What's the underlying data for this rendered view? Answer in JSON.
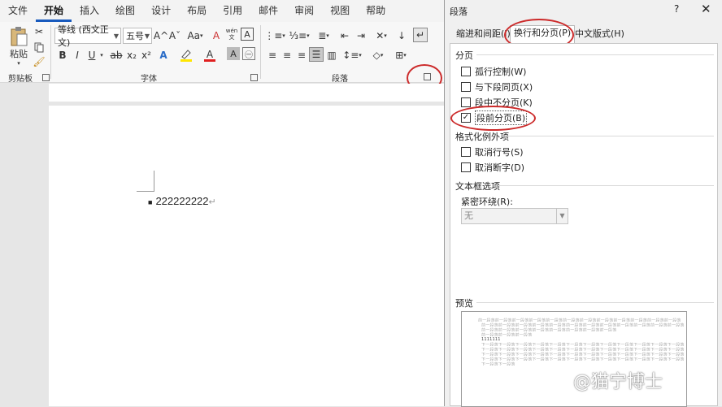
{
  "ribbon_tabs": [
    "文件",
    "开始",
    "插入",
    "绘图",
    "设计",
    "布局",
    "引用",
    "邮件",
    "审阅",
    "视图",
    "帮助"
  ],
  "clipboard": {
    "paste_label": "粘贴",
    "group_label": "剪贴板"
  },
  "font": {
    "font_name": "等线 (西文正文)",
    "font_size": "五号",
    "group_label": "字体",
    "grow": "A^",
    "shrink": "Aˇ",
    "case": "Aa",
    "bold": "B",
    "italic": "I",
    "underline": "U",
    "strike": "ab",
    "subscript": "x₂",
    "superscript": "x²",
    "clear": "A",
    "phonetic": "wén"
  },
  "paragraph": {
    "group_label": "段落"
  },
  "document": {
    "bullet_text": "222222222"
  },
  "dialog": {
    "title": "段落",
    "help": "?",
    "close": "✕",
    "tabs": [
      "缩进和间距(I)",
      "换行和分页(P)",
      "中文版式(H)"
    ],
    "section_pagination": "分页",
    "options_pagination": [
      {
        "label": "孤行控制(W)",
        "checked": false
      },
      {
        "label": "与下段同页(X)",
        "checked": false
      },
      {
        "label": "段中不分页(K)",
        "checked": false
      },
      {
        "label": "段前分页(B)",
        "checked": true
      }
    ],
    "section_format": "格式化例外项",
    "options_format": [
      {
        "label": "取消行号(S)",
        "checked": false
      },
      {
        "label": "取消断字(D)",
        "checked": false
      }
    ],
    "section_textbox": "文本框选项",
    "tight_wrap_label": "紧密环绕(R):",
    "tight_wrap_value": "无",
    "section_preview": "预览",
    "preview_lines": [
      "前一段落前一段落前一段落前一段落前一段落前一段落前一段落前一段落前一段落前一段落前一段落前一段落",
      "前一段落前一段落前一段落前一段落前一段落前一段落前一段落前一段落前一段落前一段落前一段落前一段落",
      "前一段落前一段落前一段落前一段落前一段落前一段落前一段落前一段落",
      "前一段落前一段落前一段落",
      "1111111",
      "下一段落下一段落下一段落下一段落下一段落下一段落下一段落下一段落下一段落下一段落下一段落下一段落",
      "下一段落下一段落下一段落下一段落下一段落下一段落下一段落下一段落下一段落下一段落下一段落下一段落",
      "下一段落下一段落下一段落下一段落下一段落下一段落下一段落下一段落下一段落下一段落下一段落下一段落",
      "下一段落下一段落下一段落下一段落下一段落下一段落下一段落下一段落下一段落下一段落下一段落下一段落",
      "下一段落下一段落"
    ]
  },
  "watermark": "@猫宁博士"
}
